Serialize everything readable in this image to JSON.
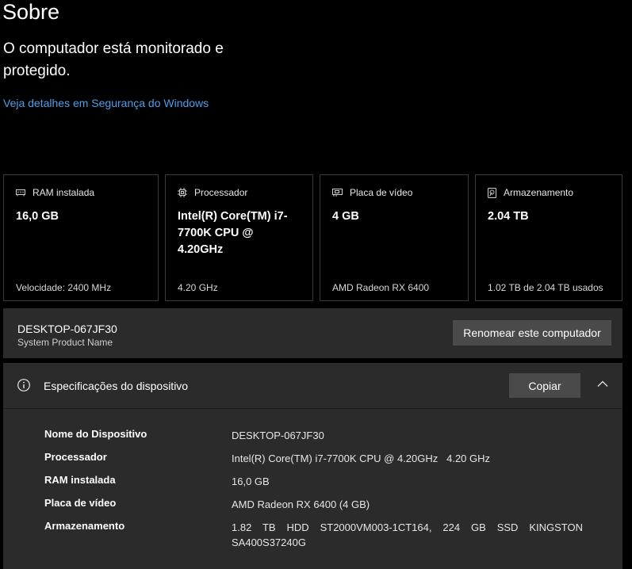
{
  "page": {
    "title": "Sobre",
    "status": "O computador está monitorado e protegido.",
    "security_link": "Veja detalhes em Segurança do Windows"
  },
  "cards": [
    {
      "icon": "ram-icon",
      "label": "RAM instalada",
      "value": "16,0 GB",
      "footer": "Velocidade: 2400 MHz"
    },
    {
      "icon": "cpu-icon",
      "label": "Processador",
      "value": "Intel(R) Core(TM) i7-7700K CPU @ 4.20GHz",
      "footer": "4.20 GHz"
    },
    {
      "icon": "gpu-icon",
      "label": "Placa de vídeo",
      "value": "4 GB",
      "footer": "AMD Radeon RX 6400"
    },
    {
      "icon": "storage-icon",
      "label": "Armazenamento",
      "value": "2.04 TB",
      "footer": "1.02 TB de 2.04 TB usados"
    }
  ],
  "device": {
    "name": "DESKTOP-067JF30",
    "model": "System Product Name",
    "rename_label": "Renomear este computador"
  },
  "specs": {
    "title": "Especificações do dispositivo",
    "copy_label": "Copiar",
    "rows": [
      {
        "key": "Nome do Dispositivo",
        "value": "DESKTOP-067JF30"
      },
      {
        "key": "Processador",
        "value": "Intel(R) Core(TM) i7-7700K CPU @ 4.20GHz   4.20 GHz"
      },
      {
        "key": "RAM instalada",
        "value": "16,0 GB"
      },
      {
        "key": "Placa de vídeo",
        "value": "AMD Radeon RX 6400 (4 GB)"
      },
      {
        "key": "Armazenamento",
        "value": "1.82 TB HDD ST2000VM003-1CT164, 224 GB SSD KINGSTON SA400S37240G"
      }
    ]
  }
}
